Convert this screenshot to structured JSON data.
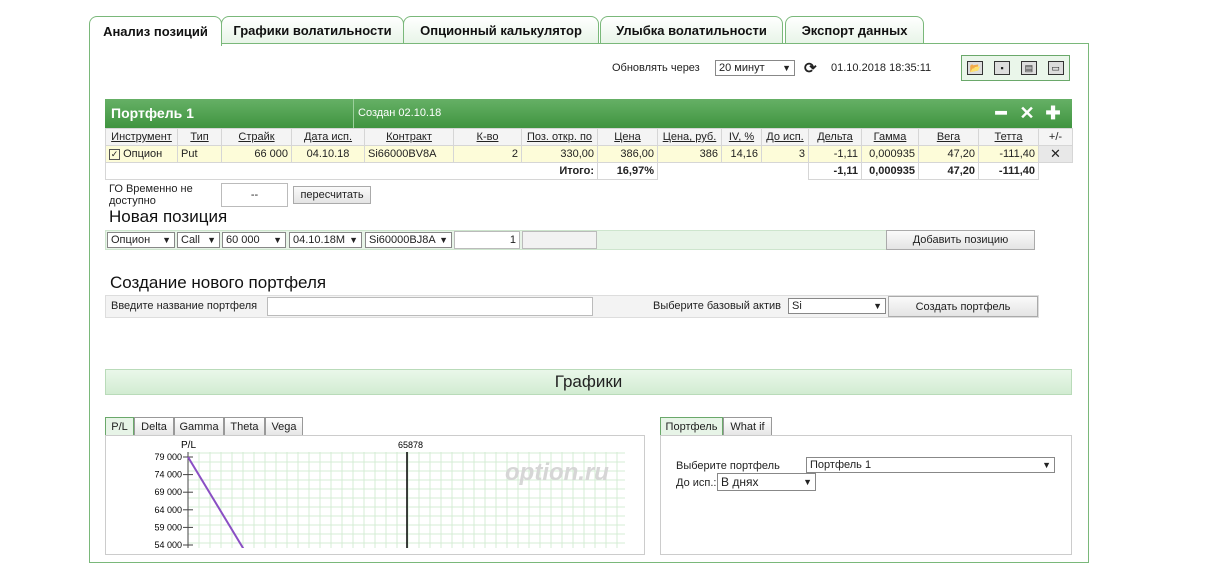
{
  "tabs": [
    {
      "label": "Анализ позиций",
      "active": true
    },
    {
      "label": "Графики волатильности"
    },
    {
      "label": "Опционный калькулятор"
    },
    {
      "label": "Улыбка волатильности"
    },
    {
      "label": "Экспорт данных"
    }
  ],
  "toolbar": {
    "refresh_label": "Обновлять через",
    "refresh_value": "20 минут",
    "datetime": "01.10.2018 18:35:11"
  },
  "portfolio": {
    "title": "Портфель 1",
    "created": "Создан 02.10.18",
    "columns": [
      "Инструмент",
      "Тип",
      "Страйк",
      "Дата исп.",
      "Контракт",
      "К-во",
      "Поз. откр. по",
      "Цена",
      "Цена, руб.",
      "IV, %",
      "До исп.",
      "Дельта",
      "Гамма",
      "Вега",
      "Тетта",
      "+/-"
    ],
    "row": {
      "instrument": "Опцион",
      "type": "Put",
      "strike": "66 000",
      "date": "04.10.18",
      "contract": "Si66000BV8A",
      "qty": "2",
      "open": "330,00",
      "price": "386,00",
      "price_rub": "386",
      "iv": "14,16",
      "days": "3",
      "delta": "-1,11",
      "gamma": "0,000935",
      "vega": "47,20",
      "theta": "-111,40"
    },
    "total": {
      "label": "Итого:",
      "price": "16,97%",
      "delta": "-1,11",
      "gamma": "0,000935",
      "vega": "47,20",
      "theta": "-111,40"
    }
  },
  "go": {
    "label": "ГО Временно не доступно",
    "value": "--",
    "recalc": "пересчитать"
  },
  "new_position": {
    "title": "Новая позиция",
    "instrument": "Опцион",
    "type": "Call",
    "strike": "60 000",
    "date": "04.10.18М",
    "contract": "Si60000BJ8A",
    "qty": "1",
    "add_button": "Добавить позицию"
  },
  "new_portfolio": {
    "title": "Создание нового портфеля",
    "name_label": "Введите название портфеля",
    "asset_label": "Выберите базовый актив",
    "asset_value": "Si",
    "create_button": "Создать портфель"
  },
  "charts_header": "Графики",
  "chart_tabs": [
    "P/L",
    "Delta",
    "Gamma",
    "Theta",
    "Vega"
  ],
  "right_tabs": [
    "Портфель",
    "What if"
  ],
  "right_panel": {
    "select_label": "Выберите портфель",
    "select_value": "Портфель 1",
    "exp_label": "До исп.:",
    "exp_value": "В днях"
  },
  "chart_data": {
    "type": "line",
    "title": "",
    "ylabel": "P/L",
    "marker_label": "65878",
    "watermark": "option.ru",
    "y_ticks": [
      "79 000",
      "74 000",
      "69 000",
      "64 000",
      "59 000",
      "54 000"
    ],
    "series": [
      {
        "x_pct": [
          0,
          0.13
        ],
        "values": [
          79000,
          54000
        ]
      }
    ],
    "line_color": "#8a4fc4"
  }
}
